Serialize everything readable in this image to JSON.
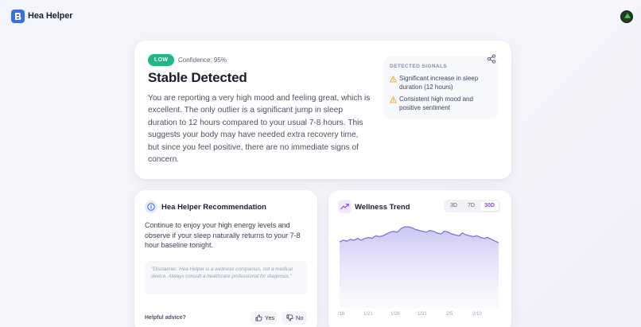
{
  "app": {
    "title": "Hea Helper",
    "brand_color": "#3a6fe0",
    "logo_icon": "app-logo-icon",
    "avatar_icon": "avatar-tree-icon"
  },
  "status": {
    "badge": "LOW",
    "badge_color": "#1eb882",
    "confidence": "Confidence: 95%",
    "title": "Stable Detected",
    "summary": "You are reporting a very high mood and feeling great, which is excellent. The only outlier is a significant jump in sleep duration to 12 hours compared to your usual 7-8 hours. This suggests your body may have needed extra recovery time, but since you feel positive, there are no immediate signs of concern.",
    "share_icon": "share-icon"
  },
  "signals": {
    "title": "DETECTED SIGNALS",
    "warning_color": "#e8a23a",
    "items": [
      "Significant increase in sleep duration (12 hours)",
      "Consistent high mood and positive sentiment"
    ]
  },
  "recommendation": {
    "title": "Hea Helper Recommendation",
    "text": "Continue to enjoy your high energy levels and observe if your sleep naturally returns to your 7-8 hour baseline tonight.",
    "disclaimer": "\"Disclaimer: Hea Helper is a wellness companion, not a medical device. Always consult a healthcare professional for diagnosis.\"",
    "helpful_label": "Helpful advice?",
    "yes_label": "Yes",
    "no_label": "No"
  },
  "trend": {
    "title": "Wellness Trend",
    "ranges": [
      "3D",
      "7D",
      "30D"
    ],
    "active_range": "30D",
    "accent_color": "#8a46e0",
    "line_color": "#7c74d6"
  },
  "chart_data": {
    "type": "area",
    "title": "",
    "xlabel": "",
    "ylabel": "",
    "x_tick_labels": [
      "/16",
      "1/21",
      "1/26",
      "1/31",
      "2/5",
      "2/10"
    ],
    "grid": false,
    "ylim": [
      0,
      100
    ],
    "series": [
      {
        "values": [
          74,
          76,
          75,
          77,
          76,
          78,
          76,
          78,
          79,
          78,
          81,
          80,
          81,
          83,
          85,
          86,
          85,
          89,
          91,
          91,
          90,
          88,
          87,
          86,
          85,
          87,
          86,
          84,
          83,
          86,
          85,
          83,
          82,
          81,
          84,
          82,
          81,
          80,
          81,
          79,
          78,
          79,
          77,
          75,
          73
        ]
      }
    ]
  }
}
